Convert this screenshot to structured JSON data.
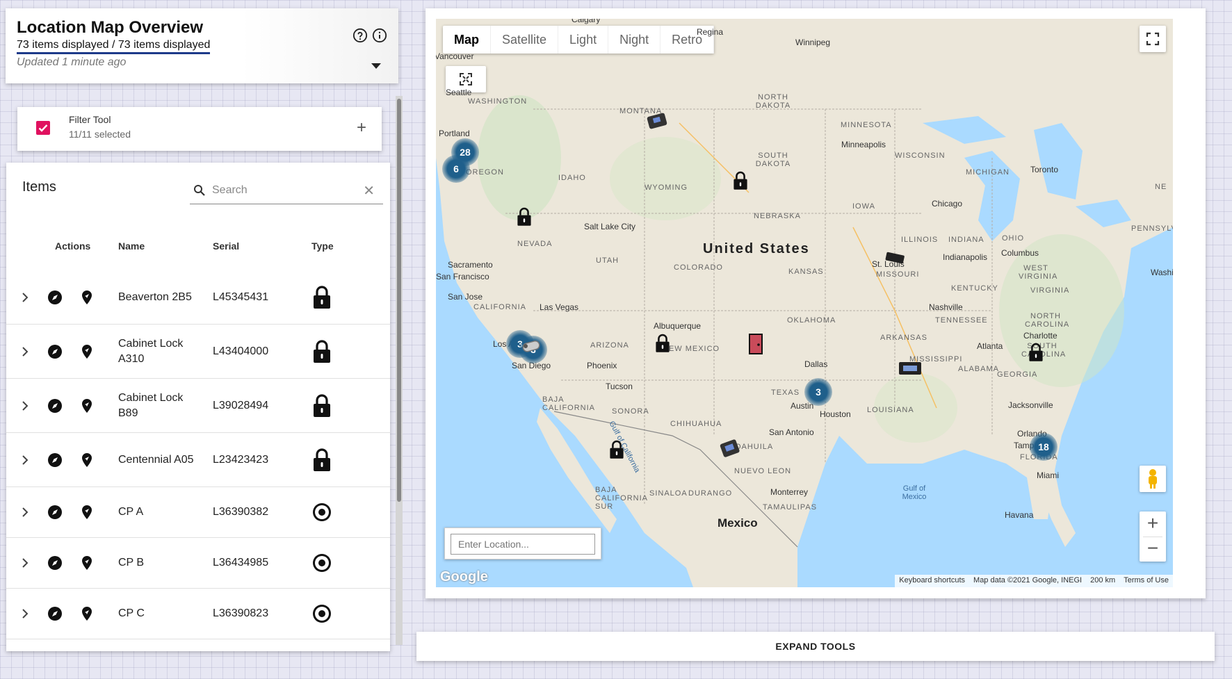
{
  "header": {
    "title": "Location Map Overview",
    "count": "73 items displayed / 73 items displayed",
    "updated": "Updated 1 minute ago"
  },
  "filter": {
    "title": "Filter Tool",
    "subtitle": "11/11 selected"
  },
  "items": {
    "title": "Items",
    "search_placeholder": "Search",
    "columns": {
      "actions": "Actions",
      "name": "Name",
      "serial": "Serial",
      "type": "Type"
    },
    "rows": [
      {
        "name": "Beaverton 2B5",
        "serial": "L45345431",
        "type": "lock-icon"
      },
      {
        "name": "Cabinet Lock A310",
        "serial": "L43404000",
        "type": "lock-icon"
      },
      {
        "name": "Cabinet Lock B89",
        "serial": "L39028494",
        "type": "lock-icon"
      },
      {
        "name": "Centennial A05",
        "serial": "L23423423",
        "type": "lock-icon"
      },
      {
        "name": "CP A",
        "serial": "L36390382",
        "type": "target-icon"
      },
      {
        "name": "CP B",
        "serial": "L36434985",
        "type": "target-icon"
      },
      {
        "name": "CP C",
        "serial": "L36390823",
        "type": "target-icon"
      }
    ]
  },
  "map": {
    "types": [
      "Map",
      "Satellite",
      "Light",
      "Night",
      "Retro"
    ],
    "active_type": "Map",
    "location_placeholder": "Enter Location...",
    "clusters": [
      "28",
      "6",
      "3",
      "3",
      "3",
      "18"
    ],
    "labels": {
      "country_us": "United States",
      "country_mx": "Mexico",
      "cities": [
        "Calgary",
        "Regina",
        "Winnipeg",
        "Vancouver",
        "Seattle",
        "Portland",
        "Minneapolis",
        "Toronto",
        "Chicago",
        "Salt Lake City",
        "Sacramento",
        "San Francisco",
        "San Jose",
        "Las Vegas",
        "Los Angeles",
        "San Diego",
        "Phoenix",
        "Tucson",
        "Albuquerque",
        "Dallas",
        "Austin",
        "Houston",
        "San Antonio",
        "St. Louis",
        "Indianapolis",
        "Columbus",
        "Washin",
        "Nashville",
        "Atlanta",
        "Charlotte",
        "Jacksonville",
        "Orlando",
        "Tampa",
        "Miami",
        "Monterrey",
        "Havana"
      ],
      "states": [
        "WASHINGTON",
        "MONTANA",
        "NORTH DAKOTA",
        "MINNESOTA",
        "SOUTH DAKOTA",
        "WISCONSIN",
        "MICHIGAN",
        "OREGON",
        "IDAHO",
        "WYOMING",
        "IOWA",
        "NEBRASKA",
        "NEVADA",
        "UTAH",
        "ILLINOIS",
        "INDIANA",
        "OHIO",
        "COLORADO",
        "KANSAS",
        "MISSOURI",
        "WEST VIRGINIA",
        "VIRGINIA",
        "KENTUCKY",
        "CALIFORNIA",
        "OKLAHOMA",
        "TENNESSEE",
        "NORTH CAROLINA",
        "ARKANSAS",
        "SOUTH CAROLINA",
        "ARIZONA",
        "NEW MEXICO",
        "MISSISSIPPI",
        "ALABAMA",
        "GEORGIA",
        "TEXAS",
        "LOUISIANA",
        "BAJA CALIFORNIA",
        "SONORA",
        "CHIHUAHUA",
        "COAHUILA",
        "NUEVO LEON",
        "SINALOA",
        "DURANGO",
        "TAMAULIPAS",
        "BAJA CALIFORNIA SUR",
        "FLORIDA",
        "NE",
        "PENNSYLVA"
      ],
      "water": [
        "Gulf of California",
        "Gulf of Mexico"
      ]
    },
    "attribution": {
      "keyboard": "Keyboard shortcuts",
      "data": "Map data ©2021 Google, INEGI",
      "scale": "200 km",
      "terms": "Terms of Use"
    },
    "google": "Google"
  },
  "expand_tools": "EXPAND TOOLS",
  "colors": {
    "accent": "#e0115f",
    "underline": "#1d3a8a",
    "cluster": "#1f5f8b"
  }
}
